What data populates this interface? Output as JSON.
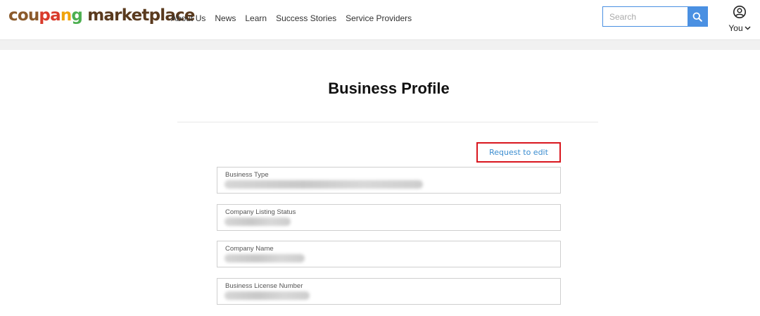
{
  "header": {
    "logo_parts": [
      {
        "text": "cou",
        "color": "#8b5a2b"
      },
      {
        "text": "pa",
        "color": "#d93b2b"
      },
      {
        "text": "n",
        "color": "#f0a30a"
      },
      {
        "text": "g",
        "color": "#4caf50"
      },
      {
        "text": " marketplace",
        "color": "#5a3a1e"
      }
    ],
    "nav": [
      "About Us",
      "News",
      "Learn",
      "Success Stories",
      "Service Providers"
    ],
    "search": {
      "placeholder": "Search",
      "value": ""
    },
    "user_label": "You",
    "accent_color": "#4a90e2"
  },
  "main": {
    "title": "Business Profile",
    "edit_button": "Request to edit",
    "highlight_color": "#d9161e",
    "fields": [
      {
        "label": "Business Type",
        "value": ""
      },
      {
        "label": "Company Listing Status",
        "value": ""
      },
      {
        "label": "Company Name",
        "value": ""
      },
      {
        "label": "Business License Number",
        "value": ""
      }
    ]
  }
}
